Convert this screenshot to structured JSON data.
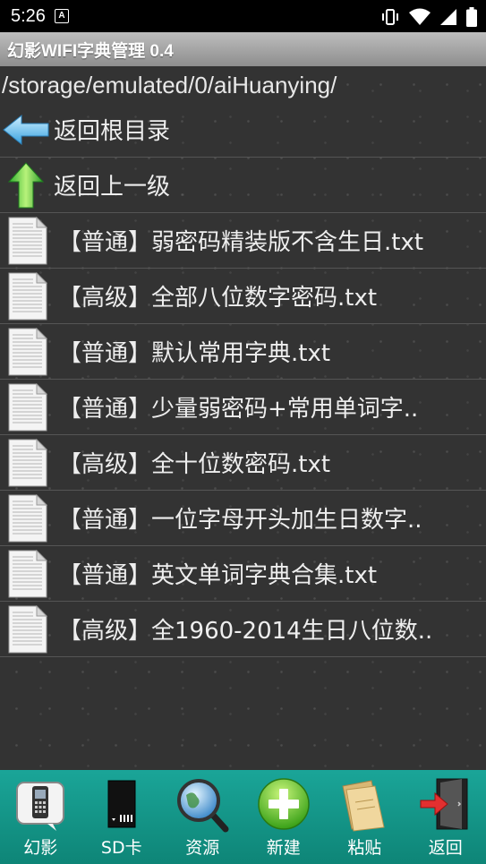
{
  "status_bar": {
    "time": "5:26",
    "notif_letter": "A"
  },
  "app": {
    "title": "幻影WIFI字典管理 0.4"
  },
  "path": "/storage/emulated/0/aiHuanying/",
  "nav": [
    {
      "label": "返回根目录",
      "icon": "arrow-left-icon"
    },
    {
      "label": "返回上一级",
      "icon": "arrow-up-icon"
    }
  ],
  "files": [
    {
      "label": "【普通】弱密码精装版不含生日.txt"
    },
    {
      "label": "【高级】全部八位数字密码.txt"
    },
    {
      "label": "【普通】默认常用字典.txt"
    },
    {
      "label": "【普通】少量弱密码+常用单词字.."
    },
    {
      "label": "【高级】全十位数密码.txt"
    },
    {
      "label": "【普通】一位字母开头加生日数字.."
    },
    {
      "label": "【普通】英文单词字典合集.txt"
    },
    {
      "label": "【高级】全1960-2014生日八位数.."
    }
  ],
  "bottom_tabs": [
    {
      "label": "幻影",
      "icon": "phone-icon"
    },
    {
      "label": "SD卡",
      "icon": "sdcard-icon"
    },
    {
      "label": "资源",
      "icon": "globe-magnifier-icon"
    },
    {
      "label": "新建",
      "icon": "plus-icon"
    },
    {
      "label": "粘贴",
      "icon": "folder-icon"
    },
    {
      "label": "返回",
      "icon": "exit-door-icon"
    }
  ],
  "colors": {
    "bottom_bar": "#1aa598",
    "title_bar": "#a6a6a6",
    "background": "#333333"
  }
}
